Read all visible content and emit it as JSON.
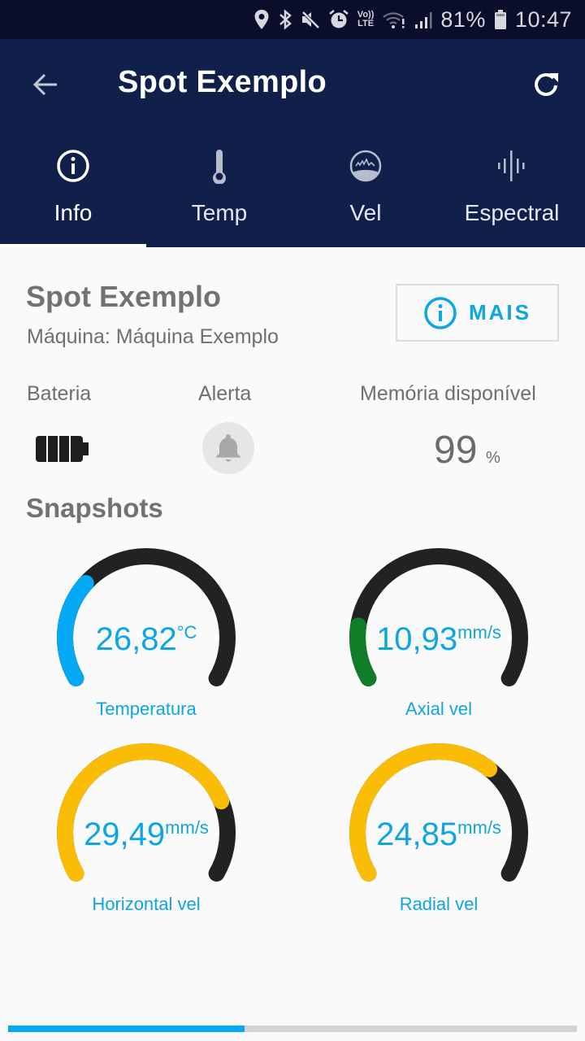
{
  "status_bar": {
    "icons": [
      "location-icon",
      "bluetooth-icon",
      "mute-icon",
      "alarm-icon",
      "volte-icon",
      "wifi-icon",
      "signal-icon"
    ],
    "volte_top": "Vo))",
    "volte_bottom": "LTE",
    "battery_percent": "81%",
    "time": "10:47"
  },
  "app_bar": {
    "title": "Spot Exemplo",
    "back_icon": "arrow-left-icon",
    "refresh_icon": "refresh-icon"
  },
  "tabs": [
    {
      "label": "Info",
      "icon": "info-icon",
      "active": true
    },
    {
      "label": "Temp",
      "icon": "thermometer-icon",
      "active": false
    },
    {
      "label": "Vel",
      "icon": "velocity-icon",
      "active": false
    },
    {
      "label": "Espectral",
      "icon": "spectrum-icon",
      "active": false
    }
  ],
  "info": {
    "device_name": "Spot Exemplo",
    "machine_line": "Máquina: Máquina Exemplo",
    "more_button": "MAIS"
  },
  "stats": {
    "battery_label": "Bateria",
    "alert_label": "Alerta",
    "memory_label": "Memória disponível",
    "memory_value": "99",
    "memory_unit": "%"
  },
  "snapshots": {
    "title": "Snapshots",
    "gauges": [
      {
        "label": "Temperatura",
        "value": "26,82",
        "unit": "°C",
        "fill_fraction": 0.3,
        "color": "#03a9f4"
      },
      {
        "label": "Axial vel",
        "value": "10,93",
        "unit": "mm/s",
        "fill_fraction": 0.16,
        "color": "#107c28"
      },
      {
        "label": "Horizontal vel",
        "value": "29,49",
        "unit": "mm/s",
        "fill_fraction": 0.78,
        "color": "#fbbc05"
      },
      {
        "label": "Radial vel",
        "value": "24,85",
        "unit": "mm/s",
        "fill_fraction": 0.66,
        "color": "#fbbc05"
      }
    ],
    "track_color": "#222222"
  },
  "page_progress": {
    "fraction": 0.415
  }
}
